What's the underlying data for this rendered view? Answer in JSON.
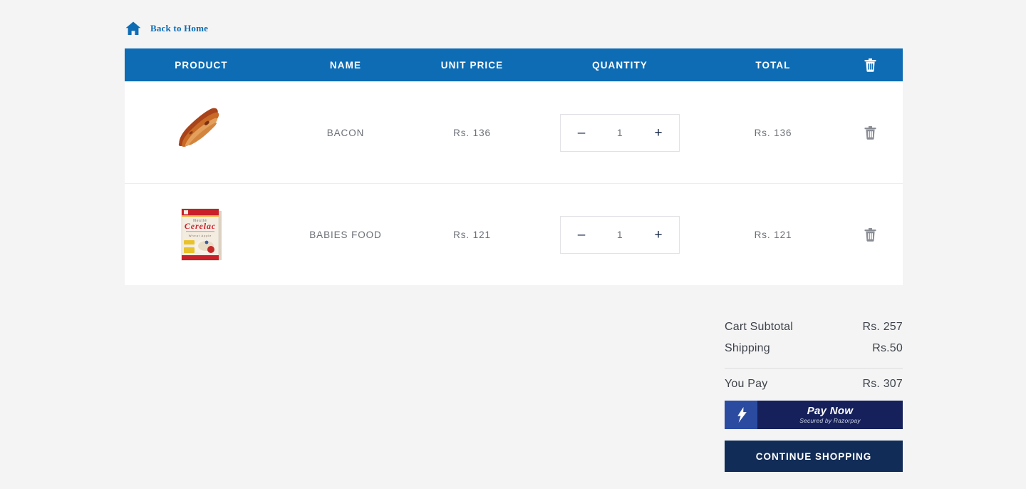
{
  "nav": {
    "back_home_label": "Back to Home",
    "home_icon": "home-icon"
  },
  "table": {
    "headers": {
      "product": "PRODUCT",
      "name": "NAME",
      "unit_price": "UNIT PRICE",
      "quantity": "QUANTITY",
      "total": "TOTAL",
      "delete_icon": "trash-icon"
    },
    "rows": [
      {
        "image": "bacon-strip-image",
        "name": "BACON",
        "unit_price": "Rs. 136",
        "decrement": "–",
        "quantity": "1",
        "increment": "+",
        "total": "Rs. 136",
        "delete_icon": "trash-icon"
      },
      {
        "image": "cerelac-box-image",
        "name": "BABIES FOOD",
        "unit_price": "Rs. 121",
        "decrement": "–",
        "quantity": "1",
        "increment": "+",
        "total": "Rs. 121",
        "delete_icon": "trash-icon"
      }
    ]
  },
  "summary": {
    "subtotal_label": "Cart Subtotal",
    "subtotal_value": "Rs. 257",
    "shipping_label": "Shipping",
    "shipping_value": "Rs.50",
    "youpay_label": "You Pay",
    "youpay_value": "Rs. 307"
  },
  "actions": {
    "pay_now_label": "Pay Now",
    "pay_now_sub": "Secured by Razorpay",
    "continue_label": "CONTINUE SHOPPING"
  },
  "colors": {
    "header_blue": "#0d6cb4",
    "link_blue": "#0e6cb4",
    "navy": "#112c56",
    "razorpay_navy": "#16215b",
    "razorpay_blue": "#2a4ba0",
    "page_bg": "#f4f4f4",
    "text_gray": "#6b6f76"
  }
}
